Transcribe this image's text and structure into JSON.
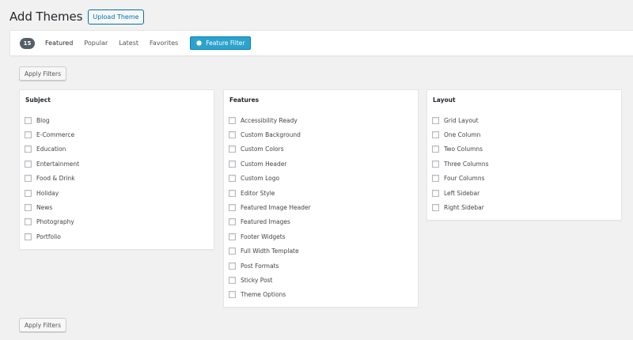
{
  "header": {
    "title": "Add Themes",
    "upload_label": "Upload Theme"
  },
  "filter_bar": {
    "count": "15",
    "links": [
      {
        "label": "Featured",
        "current": true
      },
      {
        "label": "Popular"
      },
      {
        "label": "Latest"
      },
      {
        "label": "Favorites"
      }
    ],
    "feature_filter_label": "Feature Filter",
    "feature_filter_icon": "gear-icon"
  },
  "apply_label": "Apply Filters",
  "groups": {
    "subject": {
      "title": "Subject",
      "options": [
        "Blog",
        "E-Commerce",
        "Education",
        "Entertainment",
        "Food & Drink",
        "Holiday",
        "News",
        "Photography",
        "Portfolio"
      ]
    },
    "features": {
      "title": "Features",
      "options": [
        "Accessibility Ready",
        "Custom Background",
        "Custom Colors",
        "Custom Header",
        "Custom Logo",
        "Editor Style",
        "Featured Image Header",
        "Featured Images",
        "Footer Widgets",
        "Full Width Template",
        "Post Formats",
        "Sticky Post",
        "Theme Options"
      ]
    },
    "layout": {
      "title": "Layout",
      "options": [
        "Grid Layout",
        "One Column",
        "Two Columns",
        "Three Columns",
        "Four Columns",
        "Left Sidebar",
        "Right Sidebar"
      ]
    }
  },
  "colors": {
    "accent": "#0073aa",
    "feature_button": "#2ea2cc",
    "badge": "#555d66",
    "background": "#f1f1f1"
  }
}
